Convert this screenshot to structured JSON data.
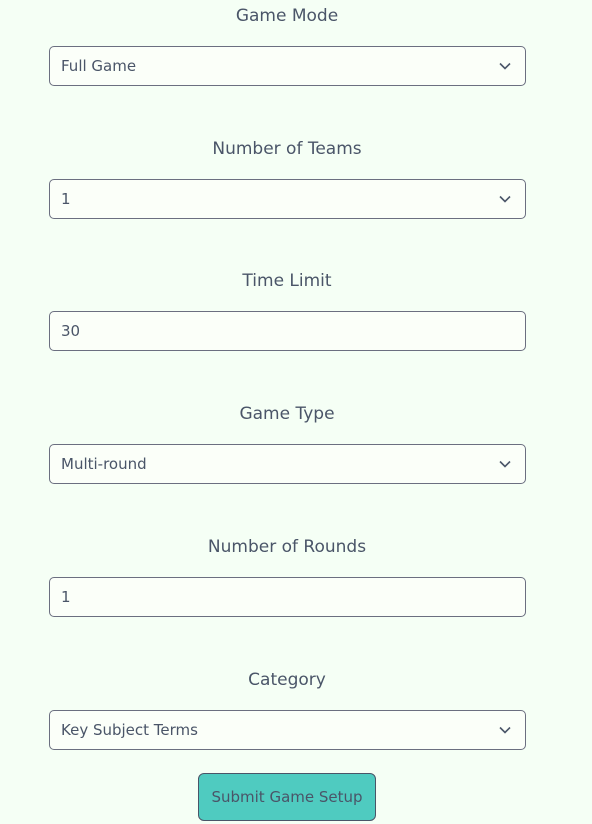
{
  "form": {
    "game_mode": {
      "label": "Game Mode",
      "value": "Full Game"
    },
    "num_teams": {
      "label": "Number of Teams",
      "value": "1"
    },
    "time_limit": {
      "label": "Time Limit",
      "value": "30"
    },
    "game_type": {
      "label": "Game Type",
      "value": "Multi-round"
    },
    "num_rounds": {
      "label": "Number of Rounds",
      "value": "1"
    },
    "category": {
      "label": "Category",
      "value": "Key Subject Terms"
    },
    "submit_label": "Submit Game Setup"
  },
  "icons": {
    "select_arrow": "chevron-down-icon"
  },
  "colors": {
    "background": "#f5fff5",
    "text": "#4a5568",
    "border": "#6b6f80",
    "button": "#4fcbc0"
  }
}
